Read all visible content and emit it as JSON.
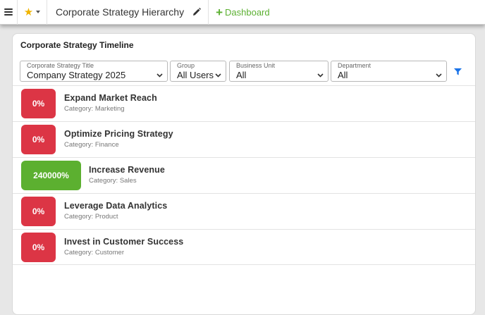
{
  "toolbar": {
    "menu_icon": "hamburger-icon",
    "favorite_icon": "star-icon",
    "page_title": "Corporate Strategy Hierarchy",
    "edit_icon": "pencil-icon",
    "dashboard_label": "Dashboard",
    "accent": "#5cb032"
  },
  "card": {
    "title": "Corporate Strategy Timeline"
  },
  "filters": [
    {
      "label": "Corporate Strategy Title",
      "value": "Company Strategy 2025"
    },
    {
      "label": "Group",
      "value": "All Users"
    },
    {
      "label": "Business Unit",
      "value": "All"
    },
    {
      "label": "Department",
      "value": "All"
    }
  ],
  "filter_icon": "filter-icon",
  "category_prefix": "Category: ",
  "strategies": [
    {
      "percent": "0%",
      "title": "Expand Market Reach",
      "category": "Marketing",
      "status": "red"
    },
    {
      "percent": "0%",
      "title": "Optimize Pricing Strategy",
      "category": "Finance",
      "status": "red"
    },
    {
      "percent": "240000%",
      "title": "Increase Revenue",
      "category": "Sales",
      "status": "green"
    },
    {
      "percent": "0%",
      "title": "Leverage Data Analytics",
      "category": "Product",
      "status": "red"
    },
    {
      "percent": "0%",
      "title": "Invest in Customer Success",
      "category": "Customer",
      "status": "red"
    }
  ],
  "colors": {
    "red": "#dc3545",
    "green": "#5cb030",
    "filter_blue": "#1a73e8"
  }
}
